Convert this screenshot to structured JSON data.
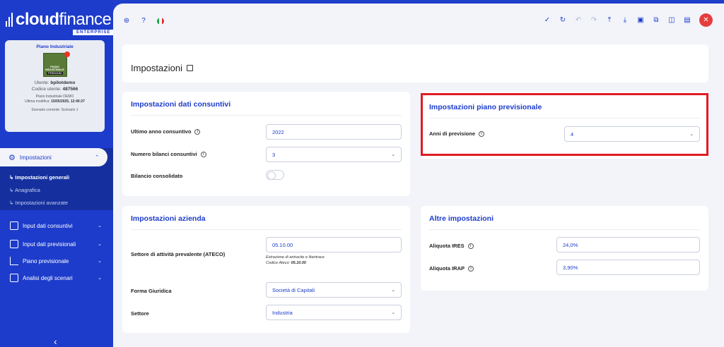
{
  "brand": {
    "name_bold": "cloud",
    "name_thin": "finance",
    "tag": "ENTERPRISE"
  },
  "plan_card": {
    "title": "Piano Industriale",
    "img_line1": "PIANO",
    "img_line2": "INDUSTRIALE",
    "img_line3": "PREMIUM",
    "user_label": "Utente:",
    "user_value": "bpilotdemo",
    "code_label": "Codice utente:",
    "code_value": "487566",
    "demo": "Piano Industriale DEMO",
    "modified_label": "Ultima modifica:",
    "modified_value": "15/05/2025, 12:40:27",
    "scenario": "Scenario corrente: Scenario 1"
  },
  "sidebar": {
    "settings_label": "Impostazioni",
    "sub_items": [
      "Impostazioni generali",
      "Anagrafica",
      "Impostazioni avanzate"
    ],
    "items": [
      {
        "label": "Input dati consuntivi",
        "icon": "edit-icon"
      },
      {
        "label": "Input dati previsionali",
        "icon": "edit-icon"
      },
      {
        "label": "Piano previsionale",
        "icon": "bar-chart-icon"
      },
      {
        "label": "Analisi degli scenari",
        "icon": "columns-icon"
      }
    ]
  },
  "page": {
    "title": "Impostazioni"
  },
  "consuntivi": {
    "title": "Impostazioni dati consuntivi",
    "ultimo_anno_label": "Ultimo anno consuntivo",
    "ultimo_anno_value": "2022",
    "numero_bilanci_label": "Numero bilanci consuntivi",
    "numero_bilanci_value": "3",
    "bilancio_label": "Bilancio consolidato"
  },
  "previsionale": {
    "title": "Impostazioni piano previsionale",
    "anni_label": "Anni di previsione",
    "anni_value": "4"
  },
  "azienda": {
    "title": "Impostazioni azienda",
    "settore_attivita_label": "Settore di attività prevalente (ATECO)",
    "ateco_value": "05.10.00",
    "ateco_hint1": "Estrazione di antracite e litantrace",
    "ateco_hint2_label": "Codice Ateco:",
    "ateco_hint2_value": "05.10.00",
    "forma_label": "Forma Giuridica",
    "forma_value": "Società di Capitali",
    "settore_label": "Settore",
    "settore_value": "Industria"
  },
  "altre": {
    "title": "Altre impostazioni",
    "ires_label": "Aliquota IRES",
    "ires_value": "24,0%",
    "irap_label": "Aliquota IRAP",
    "irap_value": "3,90%"
  },
  "colors": {
    "primary": "#1d3ccb",
    "highlight": "#e01b24",
    "close": "#e53e3e"
  }
}
